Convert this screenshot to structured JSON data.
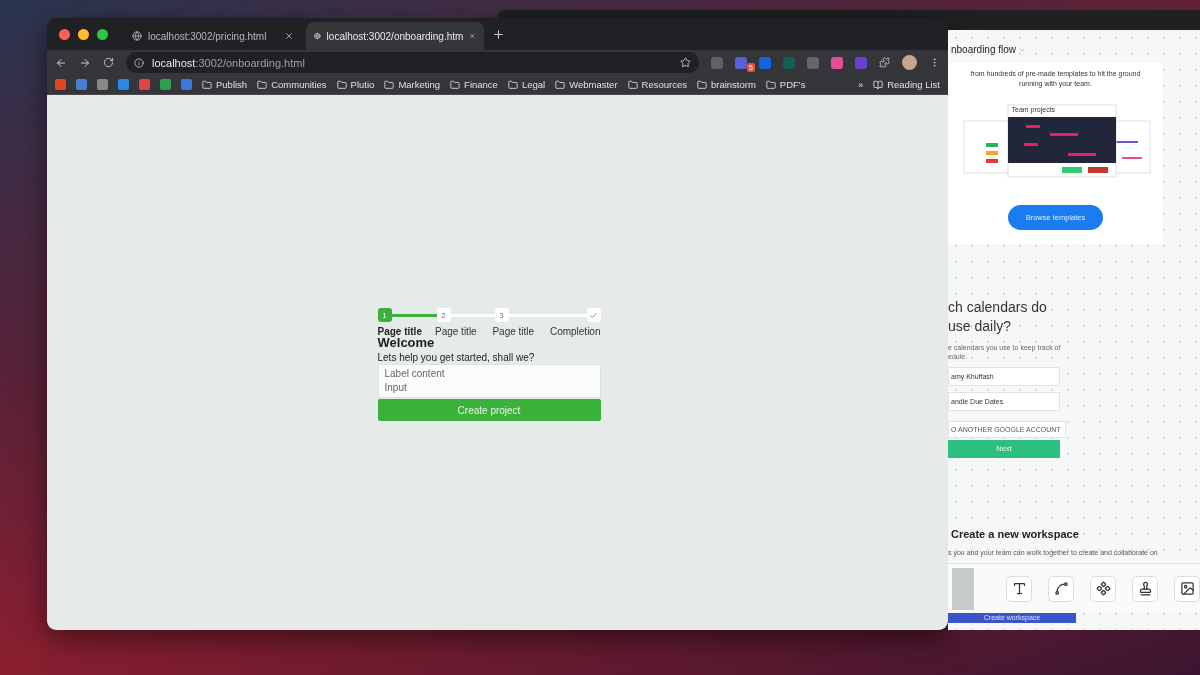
{
  "browser": {
    "tabs": [
      {
        "title": "localhost:3002/pricing.html",
        "selected": false
      },
      {
        "title": "localhost:3002/onboarding.htm",
        "selected": true
      }
    ],
    "address": {
      "host": "localhost",
      "path": ":3002/onboarding.html"
    },
    "extension_badge": "5",
    "bookmarks": [
      {
        "label": "Publish"
      },
      {
        "label": "Communities"
      },
      {
        "label": "Plutio"
      },
      {
        "label": "Marketing"
      },
      {
        "label": "Finance"
      },
      {
        "label": "Legal"
      },
      {
        "label": "Webmaster"
      },
      {
        "label": "Resources"
      },
      {
        "label": "brainstorm"
      },
      {
        "label": "PDF's"
      }
    ],
    "overflow": "»",
    "reading_list": "Reading List"
  },
  "onboarding": {
    "segments": [
      {
        "level": 1
      },
      {
        "level": 0
      },
      {
        "level": 0
      }
    ],
    "steps": [
      {
        "kind": "number",
        "number": "1",
        "label": "Page title",
        "selected": true
      },
      {
        "kind": "number",
        "number": "2",
        "label": "Page title",
        "selected": false
      },
      {
        "kind": "number",
        "number": "3",
        "label": "Page title",
        "selected": false
      },
      {
        "kind": "check",
        "label": "Completion",
        "selected": false
      }
    ],
    "title": "Welcome",
    "subtitle": "Lets help you get started, shall we?",
    "field": {
      "label": "Label content",
      "placeholder": "Input"
    },
    "button": "Create project"
  },
  "design_window": {
    "board_title": "nboarding flow",
    "templates_text": "from hundreds of pre-made templates to hit the ground running with your team.",
    "preview_title": "Team projects",
    "browse_button": "Browse templates",
    "calendar_heading": "ch calendars do use daily?",
    "calendar_text": "e calendars you use to keep track of edule.",
    "calendar_fields": [
      "amy Khuffash",
      "andle Due Dates"
    ],
    "add_account": "O ANOTHER GOOGLE ACCOUNT",
    "next_button": "Next",
    "workspace_heading": "Create a new workspace",
    "workspace_text": "s you and your team can work together to create and collaborate on",
    "workspace_button": "Create workspace"
  }
}
